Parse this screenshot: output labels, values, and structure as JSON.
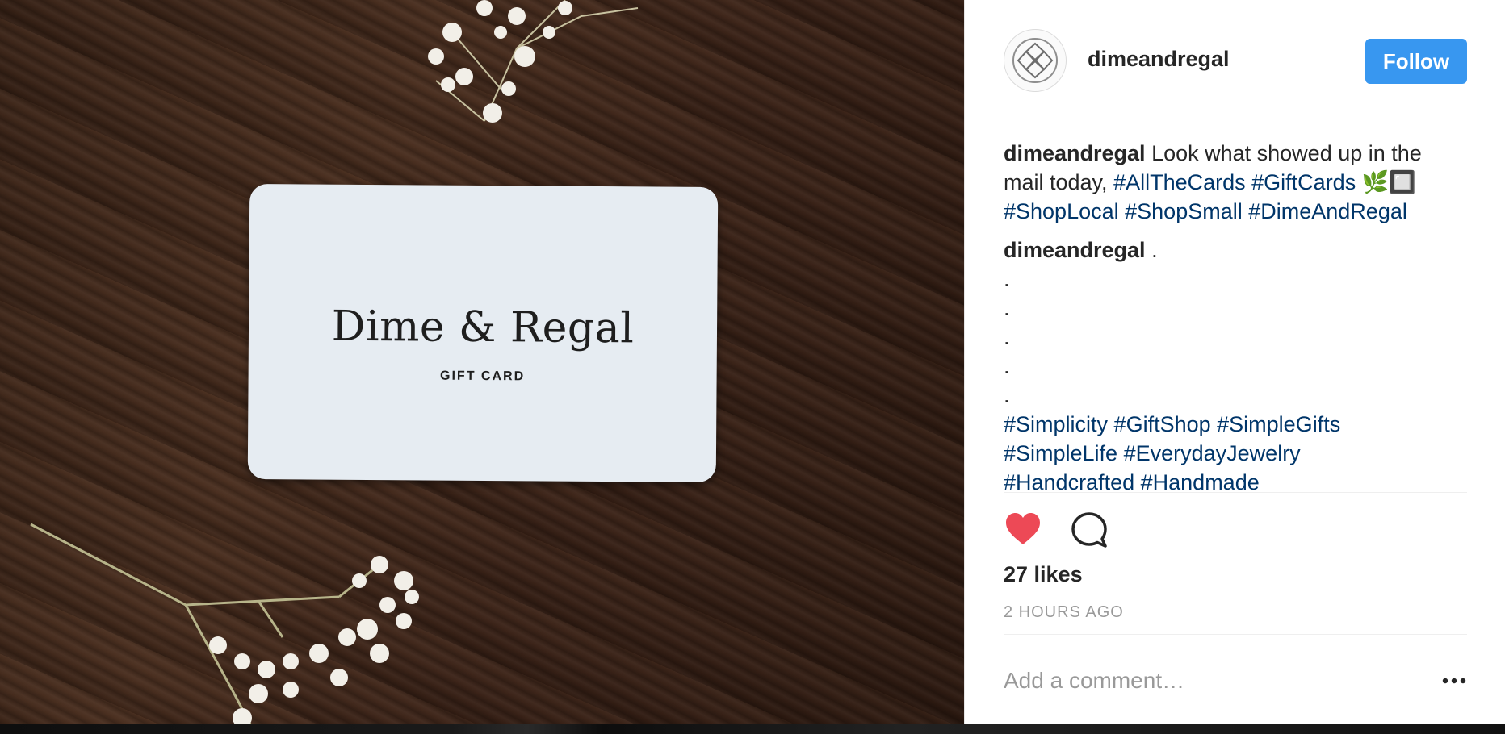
{
  "post_image": {
    "card_title": "Dime & Regal",
    "card_subtitle": "GIFT CARD"
  },
  "header": {
    "username": "dimeandregal",
    "follow_label": "Follow"
  },
  "caption": {
    "username": "dimeandregal",
    "text": " Look what showed up in the mail today, ",
    "hashtags_line1": [
      "#AllTheCards",
      "#GiftCards"
    ],
    "emoji": "🌿🔲",
    "hashtags_line2": [
      "#ShopLocal",
      "#ShopSmall",
      "#DimeAndRegal"
    ]
  },
  "comment": {
    "username": "dimeandregal",
    "text": " .",
    "dots": [
      ".",
      ".",
      ".",
      ".",
      "."
    ],
    "hashtags": [
      "#Simplicity",
      "#GiftShop",
      "#SimpleGifts",
      "#SimpleLife",
      "#EverydayJewelry",
      "#Handcrafted",
      "#Handmade"
    ]
  },
  "actions": {
    "like_icon": "heart-filled-icon",
    "comment_icon": "comment-bubble-icon",
    "like_color": "#ed4956"
  },
  "likes": "27 likes",
  "timestamp": "2 HOURS AGO",
  "comment_input": {
    "placeholder": "Add a comment…"
  },
  "more_icon": "ellipsis-icon",
  "colors": {
    "follow_button": "#3897f0",
    "hashtag": "#003569",
    "muted": "#999999"
  }
}
